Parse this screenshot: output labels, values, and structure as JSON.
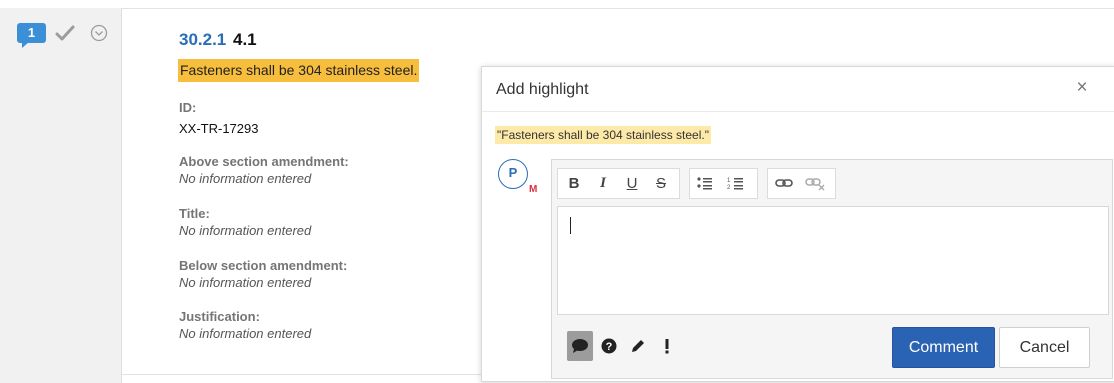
{
  "requirement": {
    "comment_count": "1",
    "section_number": "30.2.1",
    "section_title": "4.1",
    "text": "Fasteners shall be 304 stainless steel.",
    "fields": [
      {
        "label": "ID:",
        "value": "XX-TR-17293"
      },
      {
        "label": "Above section amendment:",
        "value": "No information entered"
      },
      {
        "label": "Title:",
        "value": "No information entered"
      },
      {
        "label": "Below section amendment:",
        "value": "No information entered"
      },
      {
        "label": "Justification:",
        "value": "No information entered"
      }
    ]
  },
  "popup": {
    "title": "Add highlight",
    "close_symbol": "×",
    "quote": "\"Fasteners shall be 304 stainless steel.\"",
    "avatar_letter": "P",
    "avatar_badge": "M",
    "toolbar": {
      "bold": "B",
      "italic": "I",
      "underline": "U",
      "strike": "S"
    },
    "comment_types": [
      "comment-icon",
      "question-icon",
      "pencil-icon",
      "exclamation-icon"
    ],
    "comment_button": "Comment",
    "cancel_button": "Cancel"
  },
  "colors": {
    "accent_blue": "#2b63b4",
    "highlight": "#f7bd3c",
    "quote_highlight": "#fde9a8",
    "badge_blue": "#3b8fd6"
  }
}
